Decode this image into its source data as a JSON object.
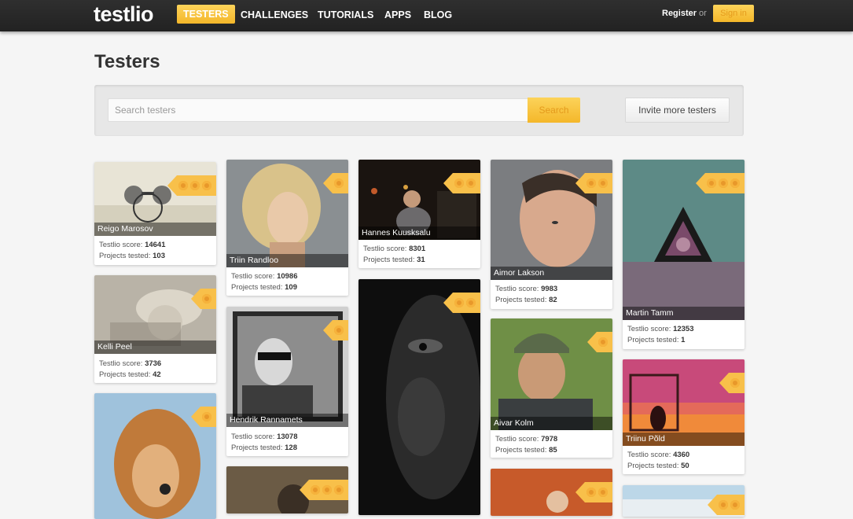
{
  "nav": {
    "logo": "testlio",
    "items": [
      "TESTERS",
      "CHALLENGES",
      "TUTORIALS",
      "APPS",
      "BLOG"
    ],
    "register": "Register",
    "or": "or",
    "signin": "Sign in"
  },
  "page": {
    "title": "Testers"
  },
  "search": {
    "placeholder": "Search testers",
    "button": "Search",
    "invite": "Invite more testers"
  },
  "labels": {
    "score": "Testlio score:",
    "projects": "Projects tested:"
  },
  "testers": [
    {
      "name": "Reigo Marosov",
      "score": "14641",
      "projects": "103",
      "dots": 3
    },
    {
      "name": "Kelli Peel",
      "score": "3736",
      "projects": "42",
      "dots": 1
    },
    {
      "name": "",
      "score": "",
      "projects": "",
      "dots": 1
    },
    {
      "name": "Triin Randloo",
      "score": "10986",
      "projects": "109",
      "dots": 1
    },
    {
      "name": "Hendrik Rannamets",
      "score": "13078",
      "projects": "128",
      "dots": 1
    },
    {
      "name": "",
      "score": "",
      "projects": "",
      "dots": 3
    },
    {
      "name": "Hannes Kuusksalu",
      "score": "8301",
      "projects": "31",
      "dots": 2
    },
    {
      "name": "",
      "score": "",
      "projects": "",
      "dots": 2
    },
    {
      "name": "Aimor Lakson",
      "score": "9983",
      "projects": "82",
      "dots": 2
    },
    {
      "name": "Aivar Kolm",
      "score": "7978",
      "projects": "85",
      "dots": 1
    },
    {
      "name": "",
      "score": "",
      "projects": "",
      "dots": 2
    },
    {
      "name": "Martin Tamm",
      "score": "12353",
      "projects": "1",
      "dots": 3
    },
    {
      "name": "Triinu Põld",
      "score": "4360",
      "projects": "50",
      "dots": 1
    },
    {
      "name": "",
      "score": "",
      "projects": "",
      "dots": 2
    }
  ]
}
